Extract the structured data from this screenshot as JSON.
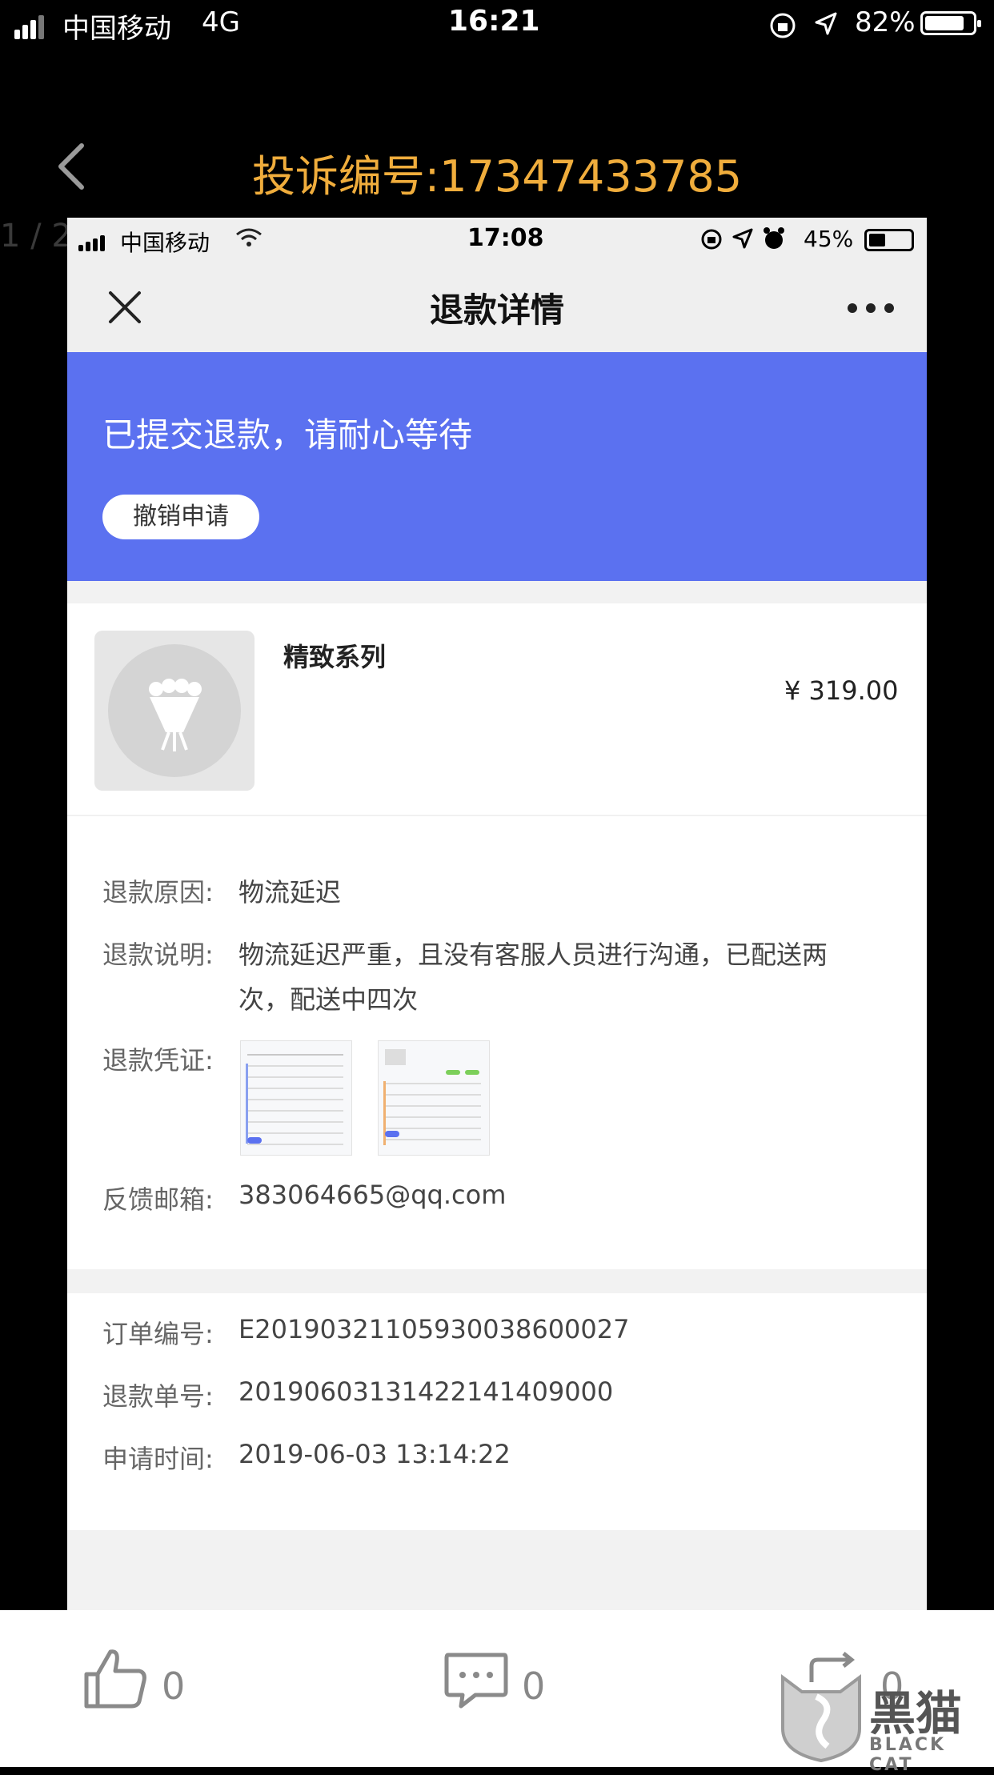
{
  "outer_status": {
    "carrier": "中国移动",
    "network": "4G",
    "time": "16:21",
    "battery": "82%"
  },
  "header": {
    "title": "投诉编号:17347433785",
    "pager": "1 / 2"
  },
  "inner_status": {
    "carrier": "中国移动",
    "time": "17:08",
    "battery": "45%"
  },
  "nav": {
    "title": "退款详情"
  },
  "banner": {
    "message": "已提交退款，请耐心等待",
    "cancel_label": "撤销申请",
    "color": "#5b71f0"
  },
  "product": {
    "name": "精致系列",
    "price": "¥  319.00"
  },
  "refund": {
    "reason_label": "退款原因:",
    "reason": "物流延迟",
    "desc_label": "退款说明:",
    "desc_line1": "物流延迟严重，且没有客服人员进行沟通，已配送两",
    "desc_line2": "次，配送中四次",
    "proof_label": "退款凭证:",
    "email_label": "反馈邮箱:",
    "email": "383064665@qq.com"
  },
  "order": {
    "order_no_label": "订单编号:",
    "order_no": "E20190321105930038600027",
    "refund_no_label": "退款单号:",
    "refund_no": "20190603131422141409000",
    "apply_time_label": "申请时间:",
    "apply_time": "2019-06-03 13:14:22"
  },
  "bottom": {
    "likes": "0",
    "comments": "0",
    "shares": "0"
  },
  "watermark": {
    "text": "黑猫",
    "sub": "BLACK CAT"
  }
}
